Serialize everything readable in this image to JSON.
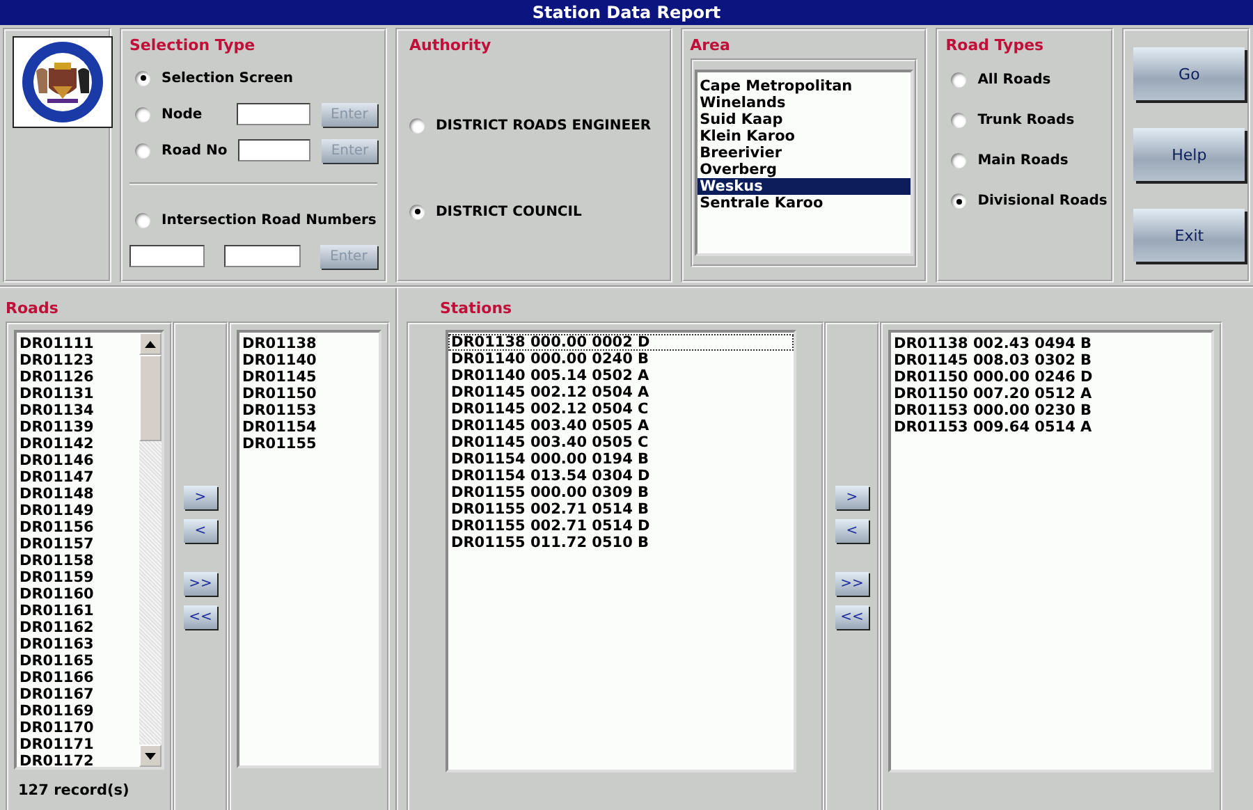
{
  "window": {
    "title": "Station Data Report"
  },
  "selection_type": {
    "title": "Selection Type",
    "options": [
      {
        "label": "Selection Screen",
        "selected": true,
        "kind": "plain"
      },
      {
        "label": "Node",
        "selected": false,
        "kind": "field",
        "enter_button": {
          "label": "Enter",
          "disabled": true
        }
      },
      {
        "label": "Road No",
        "selected": false,
        "kind": "field",
        "enter_button": {
          "label": "Enter",
          "disabled": true
        }
      },
      {
        "label": "Intersection Road Numbers",
        "selected": false,
        "kind": "intersection",
        "enter_button": {
          "label": "Enter",
          "disabled": true
        }
      }
    ]
  },
  "authority": {
    "title": "Authority",
    "options": [
      {
        "label": "DISTRICT ROADS ENGINEER",
        "selected": false
      },
      {
        "label": "DISTRICT COUNCIL",
        "selected": true
      }
    ]
  },
  "area": {
    "title": "Area",
    "items": [
      {
        "label": "Cape Metropolitan",
        "selected": false
      },
      {
        "label": "Winelands",
        "selected": false
      },
      {
        "label": "Suid Kaap",
        "selected": false
      },
      {
        "label": "Klein Karoo",
        "selected": false
      },
      {
        "label": "Breerivier",
        "selected": false
      },
      {
        "label": "Overberg",
        "selected": false
      },
      {
        "label": "Weskus",
        "selected": true
      },
      {
        "label": "Sentrale Karoo",
        "selected": false
      }
    ]
  },
  "road_types": {
    "title": "Road Types",
    "options": [
      {
        "label": "All Roads",
        "selected": false
      },
      {
        "label": "Trunk Roads",
        "selected": false
      },
      {
        "label": "Main Roads",
        "selected": false
      },
      {
        "label": "Divisional Roads",
        "selected": true
      }
    ]
  },
  "actions": [
    "Go",
    "Help",
    "Exit"
  ],
  "roads": {
    "title": "Roads",
    "available": [
      "DR01111",
      "DR01123",
      "DR01126",
      "DR01131",
      "DR01134",
      "DR01139",
      "DR01142",
      "DR01146",
      "DR01147",
      "DR01148",
      "DR01149",
      "DR01156",
      "DR01157",
      "DR01158",
      "DR01159",
      "DR01160",
      "DR01161",
      "DR01162",
      "DR01163",
      "DR01165",
      "DR01166",
      "DR01167",
      "DR01169",
      "DR01170",
      "DR01171",
      "DR01172"
    ],
    "record_count": "127 record(s)",
    "chosen": [
      "DR01138",
      "DR01140",
      "DR01145",
      "DR01150",
      "DR01153",
      "DR01154",
      "DR01155"
    ],
    "movers": [
      ">",
      "<",
      ">>",
      "<<"
    ]
  },
  "stations": {
    "title": "Stations",
    "available": [
      {
        "label": "DR01138 000.00 0002 D",
        "focused": true
      },
      {
        "label": "DR01140 000.00 0240 B",
        "focused": false
      },
      {
        "label": "DR01140 005.14 0502 A",
        "focused": false
      },
      {
        "label": "DR01145 002.12 0504 A",
        "focused": false
      },
      {
        "label": "DR01145 002.12 0504 C",
        "focused": false
      },
      {
        "label": "DR01145 003.40 0505 A",
        "focused": false
      },
      {
        "label": "DR01145 003.40 0505 C",
        "focused": false
      },
      {
        "label": "DR01154 000.00 0194 B",
        "focused": false
      },
      {
        "label": "DR01154 013.54 0304 D",
        "focused": false
      },
      {
        "label": "DR01155 000.00 0309 B",
        "focused": false
      },
      {
        "label": "DR01155 002.71 0514 B",
        "focused": false
      },
      {
        "label": "DR01155 002.71 0514 D",
        "focused": false
      },
      {
        "label": "DR01155 011.72 0510 B",
        "focused": false
      }
    ],
    "chosen": [
      "DR01138 002.43 0494 B",
      "DR01145 008.03 0302 B",
      "DR01150 000.00 0246 D",
      "DR01150 007.20 0512 A",
      "DR01153 000.00 0230 B",
      "DR01153 009.64 0514 A"
    ],
    "movers": [
      ">",
      "<",
      ">>",
      "<<"
    ]
  }
}
